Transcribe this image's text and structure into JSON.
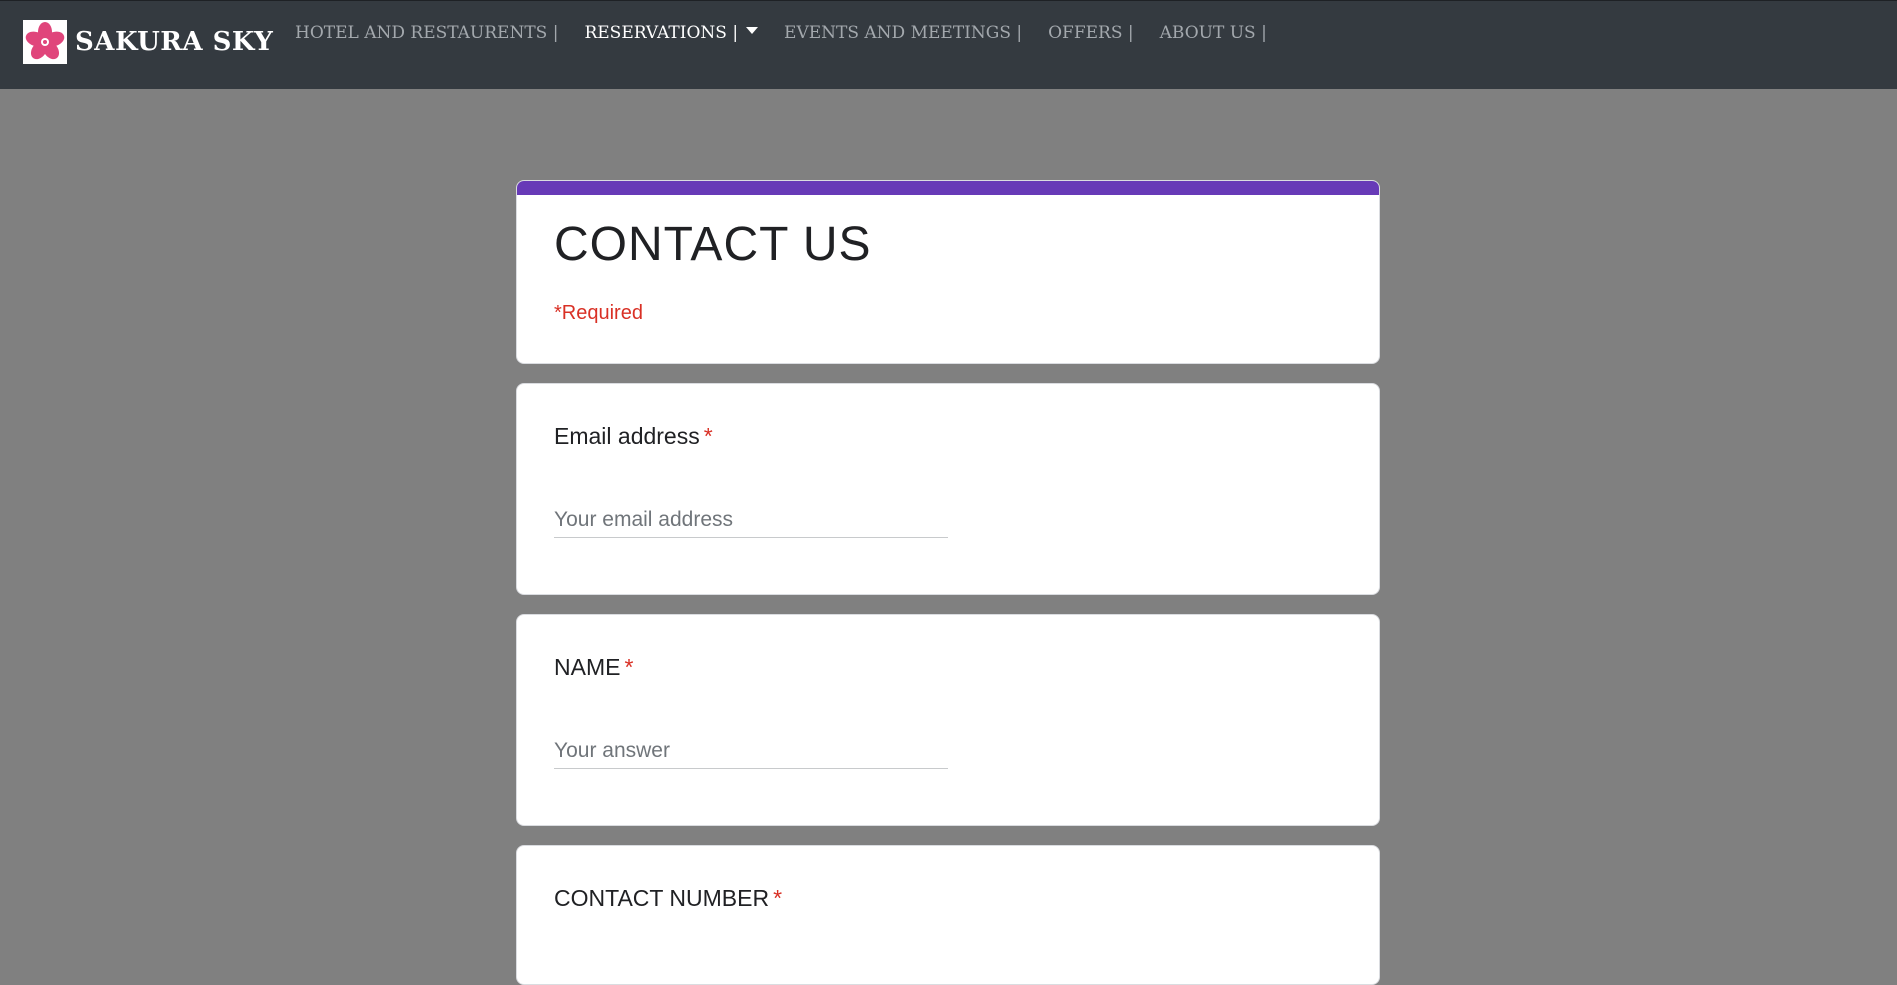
{
  "nav": {
    "brand": "SAKURA SKY",
    "items": [
      {
        "label": "HOTEL AND RESTAURENTS |"
      },
      {
        "label": "RESERVATIONS |"
      },
      {
        "label": "EVENTS AND MEETINGS |"
      },
      {
        "label": "OFFERS |"
      },
      {
        "label": "ABOUT US |"
      }
    ],
    "active_item": "RESERVATIONS |"
  },
  "form": {
    "title": "CONTACT US",
    "required_note": "*Required",
    "accent_color": "#673ab7",
    "questions": [
      {
        "label": "Email address",
        "required_mark": "*",
        "placeholder": "Your email address",
        "value": ""
      },
      {
        "label": "NAME",
        "required_mark": "*",
        "placeholder": "Your answer",
        "value": ""
      },
      {
        "label": "CONTACT NUMBER",
        "required_mark": "*"
      }
    ]
  },
  "icons": {
    "logo": "sakura-flower-icon",
    "dropdown": "caret-down-icon"
  }
}
